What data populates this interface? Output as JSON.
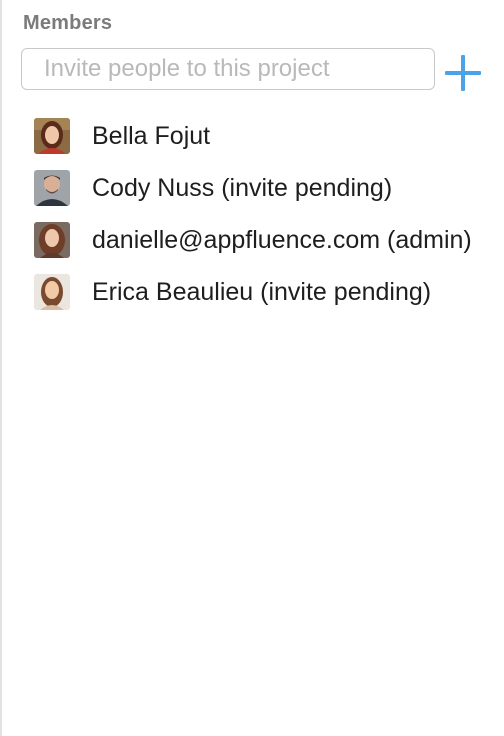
{
  "members_panel": {
    "title": "Members",
    "invite": {
      "placeholder": "Invite people to this project",
      "value": ""
    },
    "add_icon": "plus-icon",
    "accent_color": "#4aa3e8",
    "members": [
      {
        "name": "Bella Fojut"
      },
      {
        "name": "Cody Nuss (invite pending)"
      },
      {
        "name": "danielle@appfluence.com (admin)"
      },
      {
        "name": "Erica Beaulieu (invite pending)"
      }
    ]
  }
}
